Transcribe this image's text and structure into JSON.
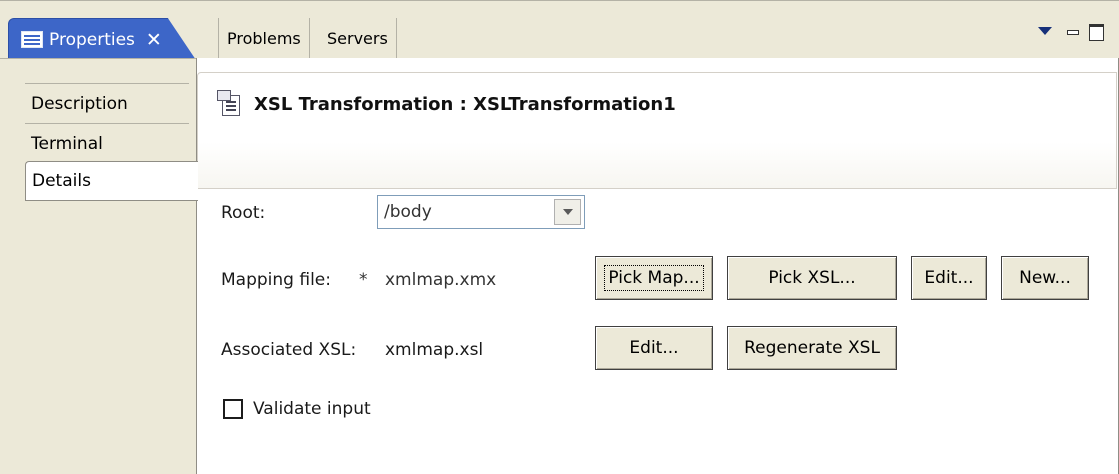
{
  "tabs": {
    "active": {
      "label": "Properties",
      "close": "✕"
    },
    "others": [
      "Problems",
      "Servers"
    ]
  },
  "side_tabs": [
    "Description",
    "Terminal",
    "Details"
  ],
  "selected_side_tab": "Details",
  "header": {
    "title": "XSL Transformation : XSLTransformation1"
  },
  "root": {
    "label": "Root:",
    "value": "/body"
  },
  "mapping": {
    "label": "Mapping file:",
    "modified_marker": "*",
    "value": "xmlmap.xmx",
    "buttons": {
      "pick_map": "Pick Map...",
      "pick_xsl": "Pick XSL...",
      "edit": "Edit...",
      "new": "New..."
    }
  },
  "associated": {
    "label": "Associated XSL:",
    "value": "xmlmap.xsl",
    "buttons": {
      "edit": "Edit...",
      "regenerate": "Regenerate XSL"
    }
  },
  "validate": {
    "label": "Validate input",
    "checked": false
  },
  "icons": {
    "properties_tab": "properties-icon",
    "view_menu": "chevron-down-icon",
    "minimize": "minimize-icon",
    "maximize": "maximize-icon",
    "header": "xsl-transformation-icon",
    "combo_arrow": "chevron-down-icon"
  },
  "colors": {
    "active_tab": "#3d66c8",
    "chrome": "#ece9d8"
  }
}
